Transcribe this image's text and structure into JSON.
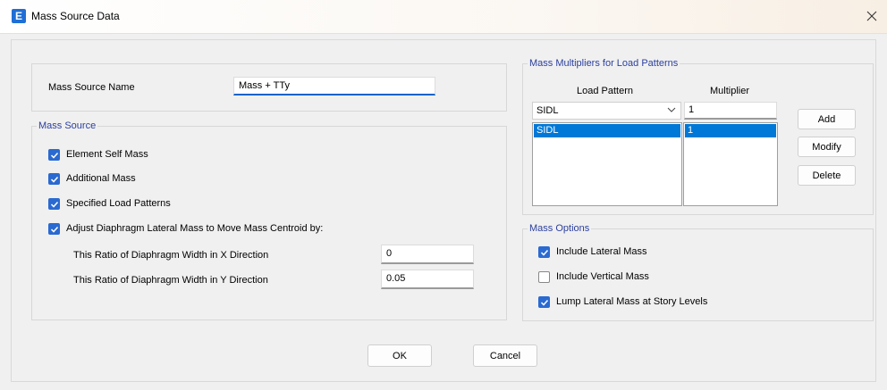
{
  "window": {
    "icon_letter": "E",
    "title": "Mass Source Data"
  },
  "mass_source_name": {
    "label": "Mass Source Name",
    "value": "Mass + TTy"
  },
  "mass_source": {
    "group_label": "Mass Source",
    "options": [
      {
        "label": "Element Self Mass",
        "checked": true
      },
      {
        "label": "Additional Mass",
        "checked": true
      },
      {
        "label": "Specified Load Patterns",
        "checked": true
      },
      {
        "label": "Adjust Diaphragm Lateral Mass to Move Mass Centroid by:",
        "checked": true
      }
    ],
    "ratio_x_label": "This Ratio of Diaphragm Width in X Direction",
    "ratio_x_value": "0",
    "ratio_y_label": "This Ratio of Diaphragm Width in Y Direction",
    "ratio_y_value": "0.05"
  },
  "multipliers": {
    "group_label": "Mass Multipliers for Load Patterns",
    "col_load_pattern": "Load Pattern",
    "col_multiplier": "Multiplier",
    "selected_pattern": "SIDL",
    "multiplier_value": "1",
    "rows": [
      {
        "load_pattern": "SIDL",
        "multiplier": "1"
      }
    ],
    "add_label": "Add",
    "modify_label": "Modify",
    "delete_label": "Delete"
  },
  "mass_options": {
    "group_label": "Mass Options",
    "options": [
      {
        "label": "Include Lateral Mass",
        "checked": true
      },
      {
        "label": "Include Vertical Mass",
        "checked": false
      },
      {
        "label": "Lump Lateral Mass at Story Levels",
        "checked": true
      }
    ]
  },
  "footer": {
    "ok_label": "OK",
    "cancel_label": "Cancel"
  },
  "colors": {
    "accent": "#2a6ad1",
    "group_label": "#2b3f9e",
    "selection": "#0078d7"
  }
}
